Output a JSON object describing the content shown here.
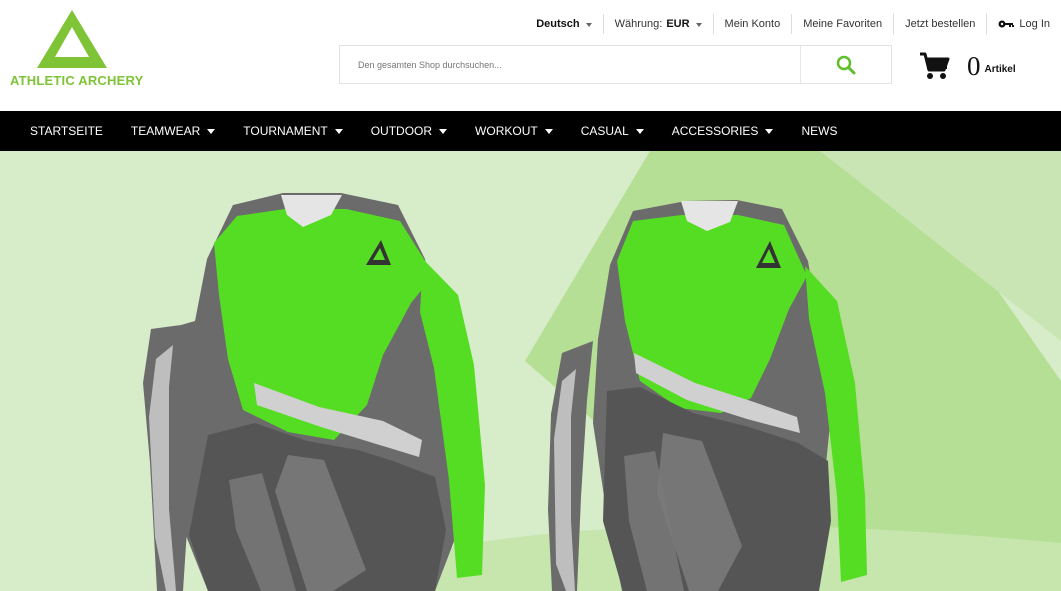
{
  "header": {
    "brand": {
      "name": "ATHLETIC ARCHERY"
    },
    "topbar": {
      "language": "Deutsch",
      "currency_label": "Währung:",
      "currency_value": "EUR",
      "account": "Mein Konto",
      "favorites": "Meine Favoriten",
      "checkout": "Jetzt bestellen",
      "login": "Log In"
    },
    "search": {
      "placeholder": "Den gesamten Shop durchsuchen..."
    },
    "cart": {
      "count": "0",
      "label": "Artikel"
    }
  },
  "nav": {
    "items": [
      {
        "label": "STARTSEITE",
        "has_dropdown": false
      },
      {
        "label": "TEAMWEAR",
        "has_dropdown": true
      },
      {
        "label": "TOURNAMENT",
        "has_dropdown": true
      },
      {
        "label": "OUTDOOR",
        "has_dropdown": true
      },
      {
        "label": "WORKOUT",
        "has_dropdown": true
      },
      {
        "label": "CASUAL",
        "has_dropdown": true
      },
      {
        "label": "ACCESSORIES",
        "has_dropdown": true
      },
      {
        "label": "NEWS",
        "has_dropdown": false
      }
    ]
  },
  "hero": {
    "background_light": "#d7ecc9",
    "background_mid": "#b5df94",
    "background_soft": "#c8e5b3",
    "jersey_gray": "#6b6b6b",
    "jersey_dark": "#555555",
    "jersey_green": "#55dd24",
    "jersey_light": "#c8c8c8"
  },
  "colors": {
    "brand_green": "#7ec436",
    "nav_bg": "#000000",
    "search_icon": "#5fbf2a"
  }
}
